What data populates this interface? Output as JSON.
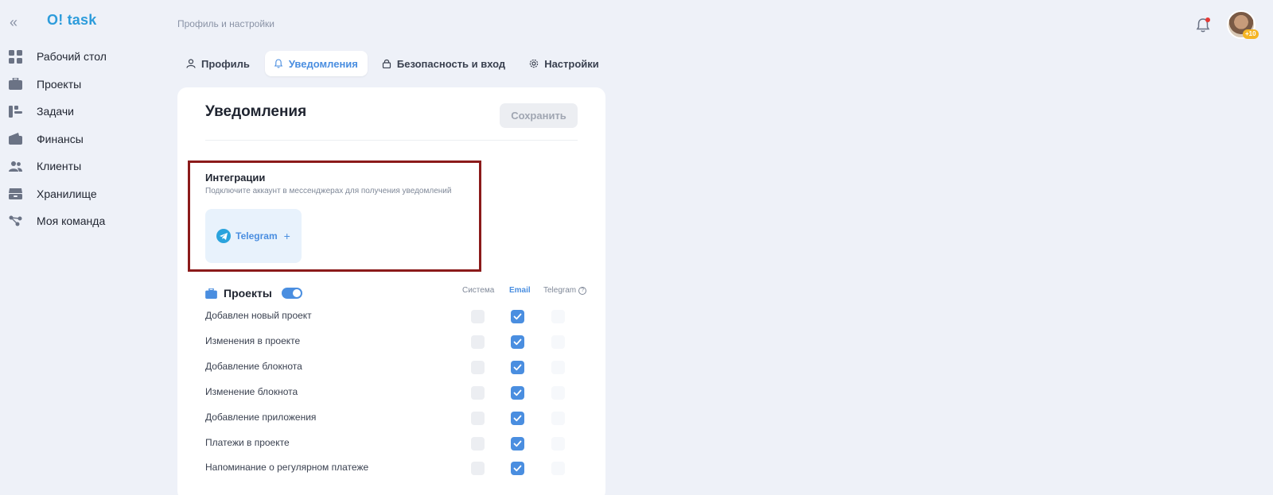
{
  "app": {
    "logo": "O! task"
  },
  "sidebar": {
    "items": [
      {
        "label": "Рабочий стол",
        "icon": "dashboard-icon"
      },
      {
        "label": "Проекты",
        "icon": "briefcase-icon"
      },
      {
        "label": "Задачи",
        "icon": "tasks-icon"
      },
      {
        "label": "Финансы",
        "icon": "wallet-icon"
      },
      {
        "label": "Клиенты",
        "icon": "users-icon"
      },
      {
        "label": "Хранилище",
        "icon": "storage-icon"
      },
      {
        "label": "Моя команда",
        "icon": "team-icon"
      }
    ]
  },
  "header": {
    "breadcrumb": "Профиль и настройки",
    "avatar_badge": "+10"
  },
  "tabs": [
    {
      "label": "Профиль",
      "icon": "user-icon",
      "active": false
    },
    {
      "label": "Уведомления",
      "icon": "bell-icon",
      "active": true
    },
    {
      "label": "Безопасность и вход",
      "icon": "lock-icon",
      "active": false
    },
    {
      "label": "Настройки",
      "icon": "gear-icon",
      "active": false
    }
  ],
  "card": {
    "title": "Уведомления",
    "save_label": "Сохранить",
    "integrations": {
      "title": "Интеграции",
      "subtitle": "Подключите аккаунт в мессенджерах для получения уведомлений",
      "telegram_label": "Telegram",
      "telegram_plus": "+"
    },
    "projects": {
      "title": "Проекты",
      "enabled": true,
      "columns": {
        "system": "Система",
        "email": "Email",
        "telegram": "Telegram",
        "help": "?"
      },
      "rows": [
        {
          "label": "Добавлен новый проект",
          "system": false,
          "email": true,
          "telegram": false
        },
        {
          "label": "Изменения в проекте",
          "system": false,
          "email": true,
          "telegram": false
        },
        {
          "label": "Добавление блокнота",
          "system": false,
          "email": true,
          "telegram": false
        },
        {
          "label": "Изменение блокнота",
          "system": false,
          "email": true,
          "telegram": false
        },
        {
          "label": "Добавление приложения",
          "system": false,
          "email": true,
          "telegram": false
        },
        {
          "label": "Платежи в проекте",
          "system": false,
          "email": true,
          "telegram": false
        },
        {
          "label": "Напоминание о регулярном платеже",
          "system": false,
          "email": true,
          "telegram": false
        }
      ]
    }
  },
  "colors": {
    "accent": "#4a8ee0",
    "logo": "#2d9cdb",
    "highlight": "#8b1a1a",
    "telegram": "#2aa3dd"
  }
}
